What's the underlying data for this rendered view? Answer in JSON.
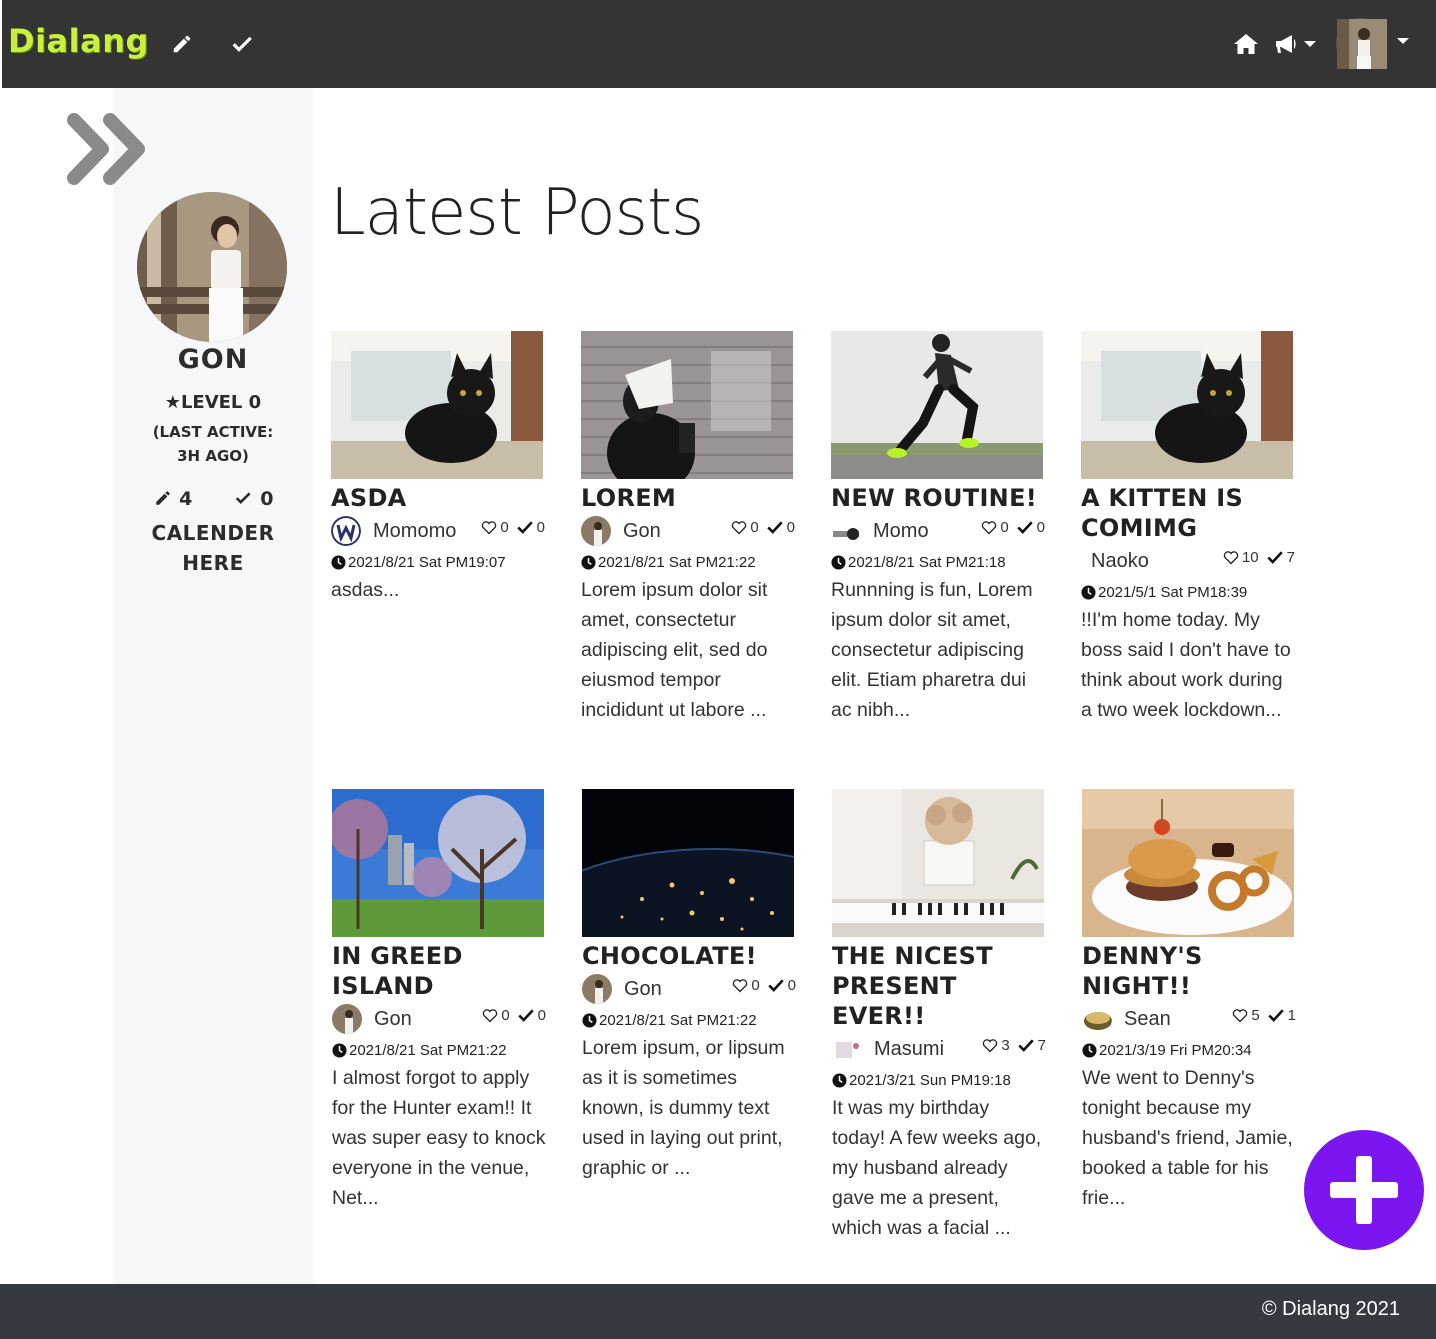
{
  "navbar": {
    "brand": "Dialang",
    "icons": [
      "pencil-icon",
      "check-icon",
      "home-icon",
      "megaphone-icon",
      "avatar"
    ]
  },
  "sidebar": {
    "name": "GON",
    "level": "LEVEL 0",
    "last_active_1": "(LAST ACTIVE:",
    "last_active_2": "3H AGO)",
    "posts_count": "4",
    "checks_count": "0",
    "calendar_line1": "CALENDER",
    "calendar_line2": "HERE"
  },
  "main": {
    "title": "Latest Posts",
    "posts": [
      {
        "title": "ASDA",
        "author": "Momomo",
        "likes": "0",
        "checks": "0",
        "date": "2021/8/21 Sat PM19:07",
        "excerpt": "asdas..."
      },
      {
        "title": "LOREM",
        "author": "Gon",
        "likes": "0",
        "checks": "0",
        "date": "2021/8/21 Sat PM21:22",
        "excerpt": "Lorem ipsum dolor sit amet, consectetur adipiscing elit, sed do eiusmod tempor incididunt ut labore ..."
      },
      {
        "title": "NEW ROUTINE!",
        "author": "Momo",
        "likes": "0",
        "checks": "0",
        "date": "2021/8/21 Sat PM21:18",
        "excerpt": "Runnning is fun, Lorem ipsum dolor sit amet, consectetur adipiscing elit. Etiam pharetra dui ac nibh..."
      },
      {
        "title": "A KITTEN IS COMIMG",
        "author": "Naoko",
        "likes": "10",
        "checks": "7",
        "date": "2021/5/1 Sat PM18:39",
        "excerpt": "!!I'm home today. My boss said I don't have to think about work during a two week lockdown..."
      },
      {
        "title": "IN GREED ISLAND",
        "author": "Gon",
        "likes": "0",
        "checks": "0",
        "date": "2021/8/21 Sat PM21:22",
        "excerpt": "I almost forgot to apply for the Hunter exam!! It was super easy to knock everyone in the venue, Net..."
      },
      {
        "title": "CHOCOLATE!",
        "author": "Gon",
        "likes": "0",
        "checks": "0",
        "date": "2021/8/21 Sat PM21:22",
        "excerpt": "Lorem ipsum, or lipsum as it is sometimes known, is dummy text used in laying out print, graphic or ..."
      },
      {
        "title": "THE NICEST PRESENT EVER!!",
        "author": "Masumi",
        "likes": "3",
        "checks": "7",
        "date": "2021/3/21 Sun PM19:18",
        "excerpt": "It was my birthday today! A few weeks ago, my husband already gave me a present, which was a facial ..."
      },
      {
        "title": "DENNY'S NIGHT!!",
        "author": "Sean",
        "likes": "5",
        "checks": "1",
        "date": "2021/3/19 Fri PM20:34",
        "excerpt": "We went to Denny's tonight because my husband's friend, Jamie, booked a table for his frie..."
      }
    ]
  },
  "fab": {
    "icon": "plus-icon",
    "color": "#7b16f0"
  },
  "footer": {
    "text": "© Dialang 2021"
  },
  "colors": {
    "navbar": "#343434",
    "brand": "#c8f03c",
    "sidebar": "#f6f7f9",
    "footer": "#343a40"
  }
}
